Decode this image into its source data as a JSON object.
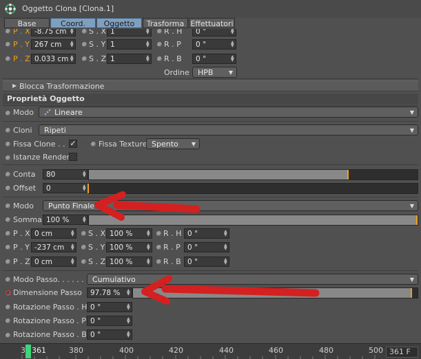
{
  "window": {
    "title": "Oggetto Clona [Clona.1]",
    "icon": "cloner-icon"
  },
  "tabs": [
    {
      "label": "Base",
      "active": false
    },
    {
      "label": "Coord.",
      "active": true
    },
    {
      "label": "Oggetto",
      "active": true
    },
    {
      "label": "Trasforma",
      "active": false
    },
    {
      "label": "Effettuatori",
      "active": false
    }
  ],
  "coord": {
    "px": {
      "label": "P . X",
      "value": "-8.75 cm"
    },
    "sx": {
      "label": "S . X",
      "value": "1"
    },
    "rh": {
      "label": "R . H",
      "value": "0 °"
    },
    "py": {
      "label": "P . Y",
      "value": "267 cm"
    },
    "sy": {
      "label": "S . Y",
      "value": "1"
    },
    "rp": {
      "label": "R . P",
      "value": "0 °"
    },
    "pz": {
      "label": "P . Z",
      "value": "0.033 cm"
    },
    "sz": {
      "label": "S . Z",
      "value": "1"
    },
    "rb": {
      "label": "R . B",
      "value": "0 °"
    },
    "order_label": "Ordine",
    "order_value": "HPB",
    "freeze_label": "Blocca Trasformazione"
  },
  "object": {
    "section_title": "Proprietà Oggetto",
    "mode_label": "Modo",
    "mode_value": "Lineare",
    "clones_label": "Cloni",
    "clones_value": "Ripeti",
    "fix_clone_label": "Fissa Clone . .",
    "fix_clone_checked": "✓",
    "fix_texture_label": "Fissa Texture",
    "fix_texture_value": "Spento",
    "render_instances_label": "Istanze Render",
    "count_label": "Conta",
    "count_value": "80",
    "offset_label": "Offset",
    "offset_value": "0",
    "mode2_label": "Modo",
    "mode2_value": "Punto Finale",
    "amount_label": "Somma",
    "amount_value": "100 %",
    "px": {
      "label": "P . X",
      "value": "0 cm"
    },
    "sx": {
      "label": "S . X",
      "value": "100 %"
    },
    "rh": {
      "label": "R . H",
      "value": "0 °"
    },
    "py": {
      "label": "P . Y",
      "value": "-237 cm"
    },
    "sy": {
      "label": "S . Y",
      "value": "100 %"
    },
    "rp": {
      "label": "R . P",
      "value": "0 °"
    },
    "pz": {
      "label": "P . Z",
      "value": "0 cm"
    },
    "sz": {
      "label": "S . Z",
      "value": "100 %"
    },
    "rb": {
      "label": "R . B",
      "value": "0 °"
    },
    "step_mode_label": "Modo Passo. . . . . . .",
    "step_mode_value": "Cumulativo",
    "step_size_label": "Dimensione Passo",
    "step_size_value": "97.78 %",
    "step_rot_h_label": "Rotazione Passo . H",
    "step_rot_h_value": "0 °",
    "step_rot_p_label": "Rotazione Passo . P",
    "step_rot_p_value": "0 °",
    "step_rot_b_label": "Rotazione Passo . B",
    "step_rot_b_value": "0 °"
  },
  "sliders": {
    "count_fraction": 0.79,
    "offset_fraction": 0.0,
    "amount_fraction": 1.0,
    "step_size_fraction": 0.98
  },
  "timeline": {
    "current_frame": "361",
    "ticks": [
      "36",
      "380",
      "400",
      "420",
      "440",
      "460",
      "480",
      "500"
    ],
    "frame_display": "361 F"
  },
  "colors": {
    "accent_orange": "#f0a020",
    "active_tab": "#7f9fbf",
    "annotation_red": "#d42020",
    "timeline_marker": "#39d77a"
  }
}
